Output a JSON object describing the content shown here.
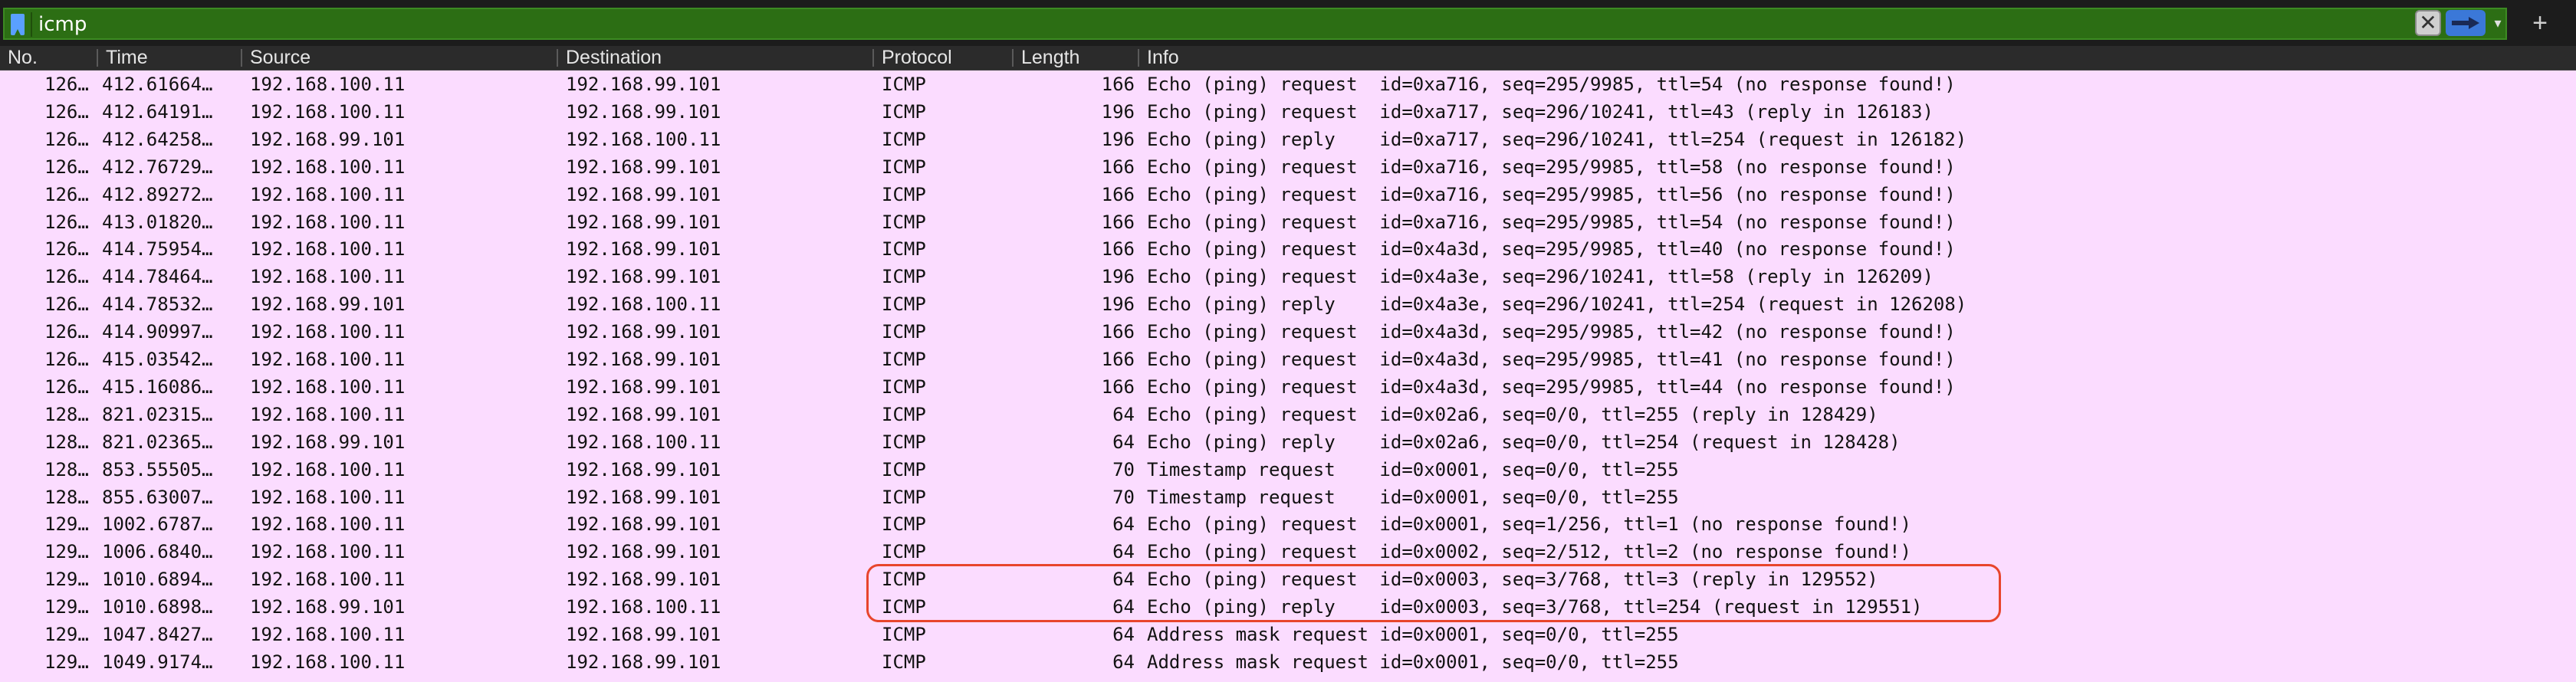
{
  "filter": {
    "value": "icmp",
    "bar_color": "#2c6e14",
    "bookmark_icon": "bookmark-icon",
    "clear_icon": "clear-icon",
    "apply_icon": "arrow-right-icon",
    "dropdown_icon": "chevron-down-icon",
    "add_icon": "plus-icon",
    "clear_label": "✕",
    "dropdown_label": "▾",
    "add_label": "+"
  },
  "columns": [
    "No.",
    "Time",
    "Source",
    "Destination",
    "Protocol",
    "Length",
    "Info"
  ],
  "row_color": "#fbdcff",
  "highlight_color": "#e8452c",
  "packets": [
    {
      "no": "126…",
      "time": "412.61664…",
      "source": "192.168.100.11",
      "destination": "192.168.99.101",
      "protocol": "ICMP",
      "length": "166",
      "info": "Echo (ping) request  id=0xa716, seq=295/9985, ttl=54 (no response found!)"
    },
    {
      "no": "126…",
      "time": "412.64191…",
      "source": "192.168.100.11",
      "destination": "192.168.99.101",
      "protocol": "ICMP",
      "length": "196",
      "info": "Echo (ping) request  id=0xa717, seq=296/10241, ttl=43 (reply in 126183)"
    },
    {
      "no": "126…",
      "time": "412.64258…",
      "source": "192.168.99.101",
      "destination": "192.168.100.11",
      "protocol": "ICMP",
      "length": "196",
      "info": "Echo (ping) reply    id=0xa717, seq=296/10241, ttl=254 (request in 126182)"
    },
    {
      "no": "126…",
      "time": "412.76729…",
      "source": "192.168.100.11",
      "destination": "192.168.99.101",
      "protocol": "ICMP",
      "length": "166",
      "info": "Echo (ping) request  id=0xa716, seq=295/9985, ttl=58 (no response found!)"
    },
    {
      "no": "126…",
      "time": "412.89272…",
      "source": "192.168.100.11",
      "destination": "192.168.99.101",
      "protocol": "ICMP",
      "length": "166",
      "info": "Echo (ping) request  id=0xa716, seq=295/9985, ttl=56 (no response found!)"
    },
    {
      "no": "126…",
      "time": "413.01820…",
      "source": "192.168.100.11",
      "destination": "192.168.99.101",
      "protocol": "ICMP",
      "length": "166",
      "info": "Echo (ping) request  id=0xa716, seq=295/9985, ttl=54 (no response found!)"
    },
    {
      "no": "126…",
      "time": "414.75954…",
      "source": "192.168.100.11",
      "destination": "192.168.99.101",
      "protocol": "ICMP",
      "length": "166",
      "info": "Echo (ping) request  id=0x4a3d, seq=295/9985, ttl=40 (no response found!)"
    },
    {
      "no": "126…",
      "time": "414.78464…",
      "source": "192.168.100.11",
      "destination": "192.168.99.101",
      "protocol": "ICMP",
      "length": "196",
      "info": "Echo (ping) request  id=0x4a3e, seq=296/10241, ttl=58 (reply in 126209)"
    },
    {
      "no": "126…",
      "time": "414.78532…",
      "source": "192.168.99.101",
      "destination": "192.168.100.11",
      "protocol": "ICMP",
      "length": "196",
      "info": "Echo (ping) reply    id=0x4a3e, seq=296/10241, ttl=254 (request in 126208)"
    },
    {
      "no": "126…",
      "time": "414.90997…",
      "source": "192.168.100.11",
      "destination": "192.168.99.101",
      "protocol": "ICMP",
      "length": "166",
      "info": "Echo (ping) request  id=0x4a3d, seq=295/9985, ttl=42 (no response found!)"
    },
    {
      "no": "126…",
      "time": "415.03542…",
      "source": "192.168.100.11",
      "destination": "192.168.99.101",
      "protocol": "ICMP",
      "length": "166",
      "info": "Echo (ping) request  id=0x4a3d, seq=295/9985, ttl=41 (no response found!)"
    },
    {
      "no": "126…",
      "time": "415.16086…",
      "source": "192.168.100.11",
      "destination": "192.168.99.101",
      "protocol": "ICMP",
      "length": "166",
      "info": "Echo (ping) request  id=0x4a3d, seq=295/9985, ttl=44 (no response found!)"
    },
    {
      "no": "128…",
      "time": "821.02315…",
      "source": "192.168.100.11",
      "destination": "192.168.99.101",
      "protocol": "ICMP",
      "length": "64",
      "info": "Echo (ping) request  id=0x02a6, seq=0/0, ttl=255 (reply in 128429)"
    },
    {
      "no": "128…",
      "time": "821.02365…",
      "source": "192.168.99.101",
      "destination": "192.168.100.11",
      "protocol": "ICMP",
      "length": "64",
      "info": "Echo (ping) reply    id=0x02a6, seq=0/0, ttl=254 (request in 128428)"
    },
    {
      "no": "128…",
      "time": "853.55505…",
      "source": "192.168.100.11",
      "destination": "192.168.99.101",
      "protocol": "ICMP",
      "length": "70",
      "info": "Timestamp request    id=0x0001, seq=0/0, ttl=255"
    },
    {
      "no": "128…",
      "time": "855.63007…",
      "source": "192.168.100.11",
      "destination": "192.168.99.101",
      "protocol": "ICMP",
      "length": "70",
      "info": "Timestamp request    id=0x0001, seq=0/0, ttl=255"
    },
    {
      "no": "129…",
      "time": "1002.6787…",
      "source": "192.168.100.11",
      "destination": "192.168.99.101",
      "protocol": "ICMP",
      "length": "64",
      "info": "Echo (ping) request  id=0x0001, seq=1/256, ttl=1 (no response found!)"
    },
    {
      "no": "129…",
      "time": "1006.6840…",
      "source": "192.168.100.11",
      "destination": "192.168.99.101",
      "protocol": "ICMP",
      "length": "64",
      "info": "Echo (ping) request  id=0x0002, seq=2/512, ttl=2 (no response found!)"
    },
    {
      "no": "129…",
      "time": "1010.6894…",
      "source": "192.168.100.11",
      "destination": "192.168.99.101",
      "protocol": "ICMP",
      "length": "64",
      "info": "Echo (ping) request  id=0x0003, seq=3/768, ttl=3 (reply in 129552)",
      "highlighted": true
    },
    {
      "no": "129…",
      "time": "1010.6898…",
      "source": "192.168.99.101",
      "destination": "192.168.100.11",
      "protocol": "ICMP",
      "length": "64",
      "info": "Echo (ping) reply    id=0x0003, seq=3/768, ttl=254 (request in 129551)",
      "highlighted": true
    },
    {
      "no": "129…",
      "time": "1047.8427…",
      "source": "192.168.100.11",
      "destination": "192.168.99.101",
      "protocol": "ICMP",
      "length": "64",
      "info": "Address mask request id=0x0001, seq=0/0, ttl=255"
    },
    {
      "no": "129…",
      "time": "1049.9174…",
      "source": "192.168.100.11",
      "destination": "192.168.99.101",
      "protocol": "ICMP",
      "length": "64",
      "info": "Address mask request id=0x0001, seq=0/0, ttl=255"
    }
  ]
}
